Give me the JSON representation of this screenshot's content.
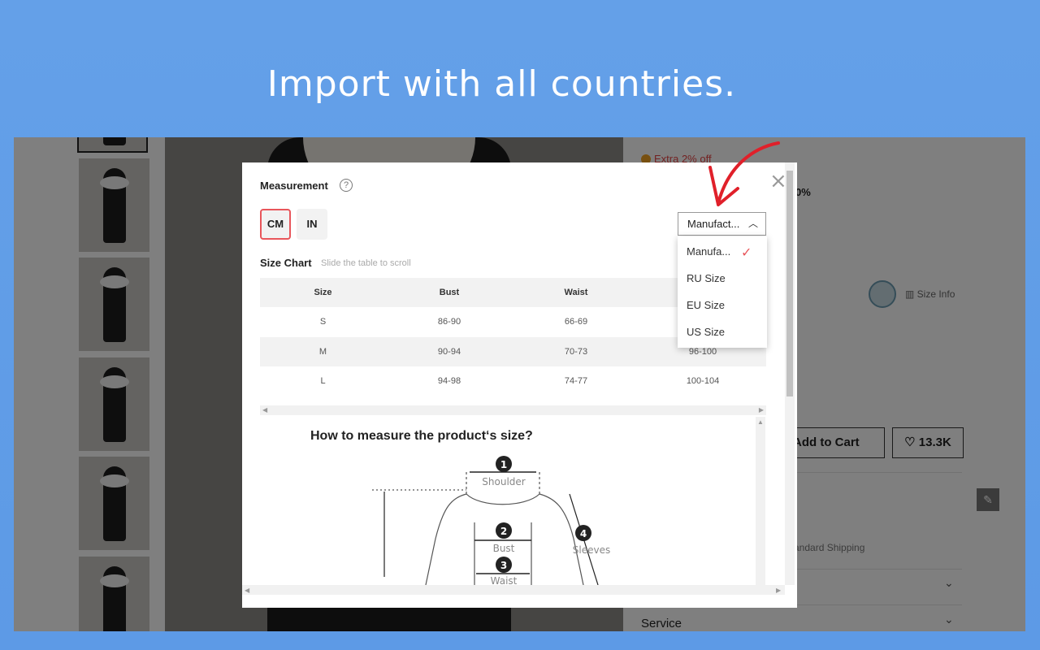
{
  "banner": {
    "headline": "Import with all countries."
  },
  "product": {
    "extra_off": "Extra 2% off",
    "percent_fragment": "0%",
    "size_info": "Size Info",
    "add_to_cart": "Add to Cart",
    "wishlist_count": "13.3K",
    "shipping_fragment": "andard Shipping",
    "service": "Service"
  },
  "modal": {
    "title": "Measurement",
    "units": [
      "CM",
      "IN"
    ],
    "selected_unit": "CM",
    "size_system_selected": "Manufact...",
    "size_system_options": [
      {
        "label": "Manufa...",
        "checked": true
      },
      {
        "label": "RU Size",
        "checked": false
      },
      {
        "label": "EU Size",
        "checked": false
      },
      {
        "label": "US Size",
        "checked": false
      }
    ],
    "size_chart_title": "Size Chart",
    "size_chart_hint": "Slide the table to scroll",
    "table": {
      "headers": [
        "Size",
        "Bust",
        "Waist",
        ""
      ],
      "rows": [
        [
          "S",
          "86-90",
          "66-69",
          ""
        ],
        [
          "M",
          "90-94",
          "70-73",
          "96-100"
        ],
        [
          "L",
          "94-98",
          "74-77",
          "100-104"
        ]
      ]
    },
    "guide": {
      "title": "How to measure the product‘s size?",
      "labels": [
        {
          "num": "1",
          "text": "Shoulder"
        },
        {
          "num": "2",
          "text": "Bust"
        },
        {
          "num": "3",
          "text": "Waist"
        },
        {
          "num": "4",
          "text": "Sleeves"
        }
      ]
    }
  },
  "colors": {
    "accent": "#e8565b",
    "banner": "#64a0e8",
    "annotation_arrow": "#e0202a"
  }
}
